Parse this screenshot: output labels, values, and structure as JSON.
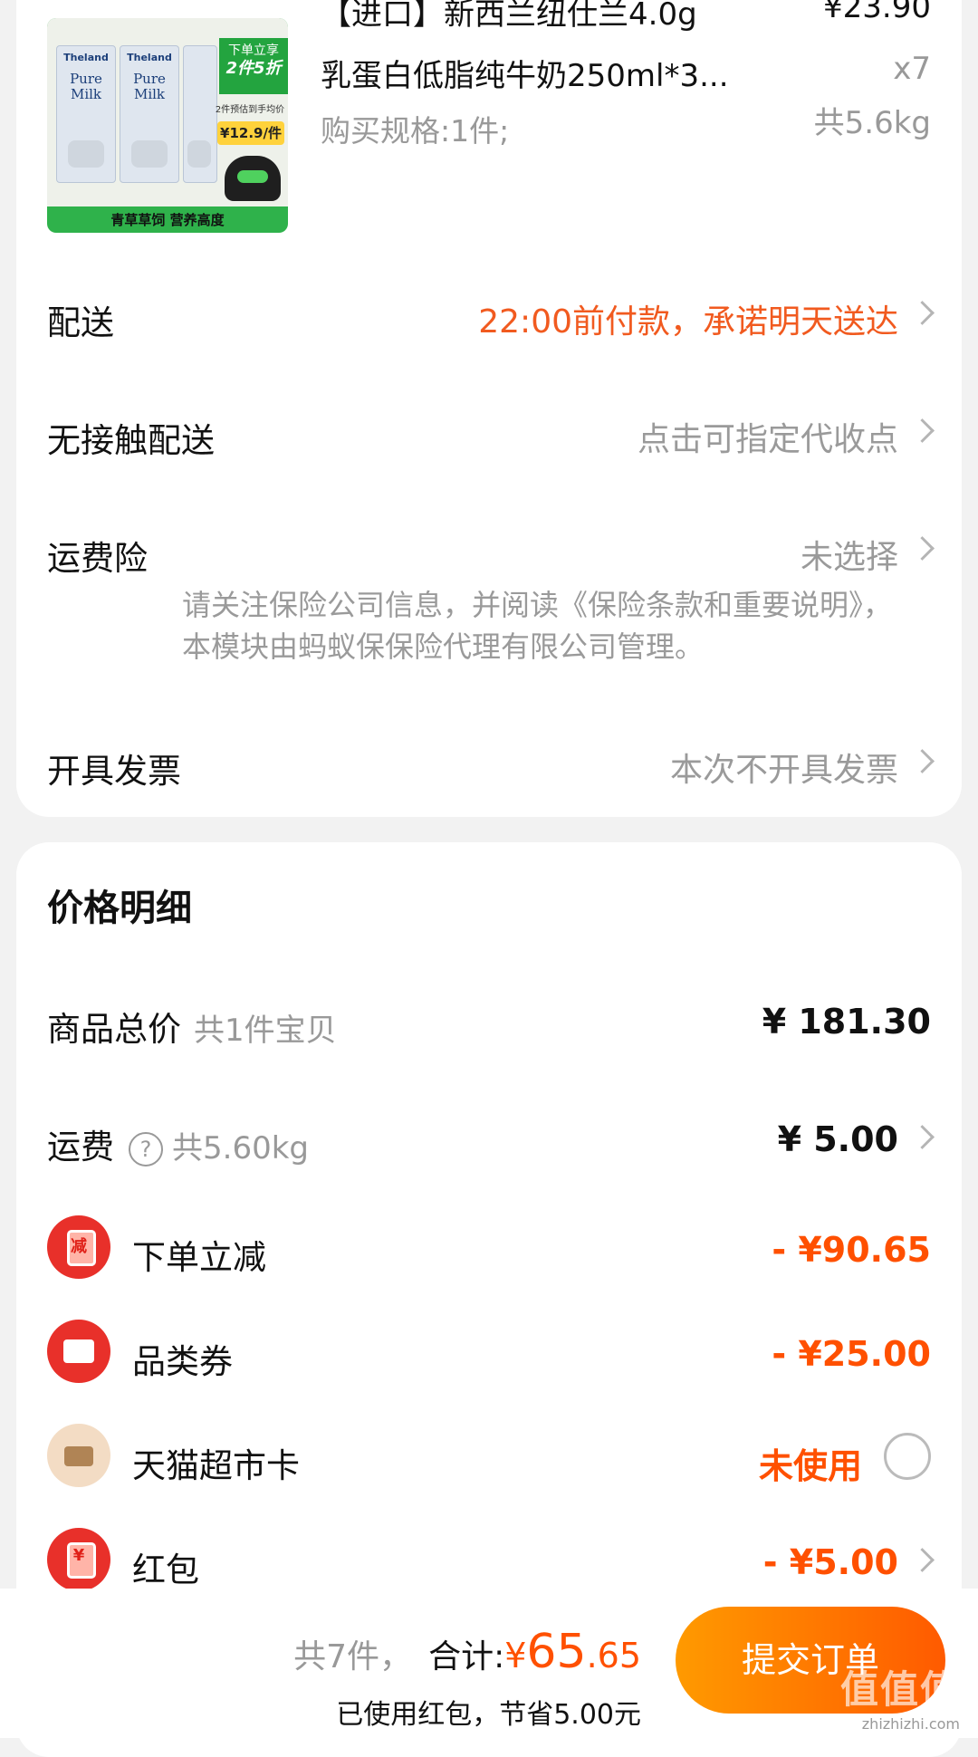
{
  "product": {
    "title_line1": "【进口】新西兰纽仕兰4.0g",
    "title_line2": "乳蛋白低脂纯牛奶250ml*3...",
    "spec": "购买规格:1件;",
    "price": "¥23.90",
    "quantity": "x7",
    "weight": "共5.6kg",
    "image": {
      "brand": "Theland",
      "pure_milk": "Pure Milk",
      "promo_line1": "下单立享",
      "promo_line2": "2件5折",
      "promo_sub": "2件预估到手均价",
      "promo_price": "¥12.9/件",
      "slogan": "青草草饲 营养高度"
    }
  },
  "rows": {
    "delivery": {
      "label": "配送",
      "value": "22:00前付款，承诺明天送达"
    },
    "contactless": {
      "label": "无接触配送",
      "value": "点击可指定代收点"
    },
    "insurance": {
      "label": "运费险",
      "value": "未选择",
      "note": "请关注保险公司信息，并阅读《保险条款和重要说明》，本模块由蚂蚁保保险代理有限公司管理。"
    },
    "invoice": {
      "label": "开具发票",
      "value": "本次不开具发票"
    }
  },
  "price_detail": {
    "title": "价格明细",
    "goods_total": {
      "label": "商品总价",
      "sub": "共1件宝贝",
      "amount": "¥ 181.30"
    },
    "shipping": {
      "label": "运费",
      "sub": "共5.60kg",
      "amount": "¥ 5.00",
      "help": "?"
    },
    "instant_discount": {
      "label": "下单立减",
      "amount": "- ¥90.65",
      "icon_glyph": "减"
    },
    "category_coupon": {
      "label": "品类券",
      "amount": "- ¥25.00"
    },
    "tmall_card": {
      "label": "天猫超市卡",
      "status": "未使用"
    },
    "red_packet": {
      "label": "红包",
      "amount": "- ¥5.00",
      "icon_glyph": "¥"
    }
  },
  "bottom": {
    "count": "共7件，",
    "total_label": "合计:",
    "currency": "¥",
    "total_int": "65",
    "total_dec": ".65",
    "saved": "已使用红包，节省5.00元",
    "submit": "提交订单",
    "watermark": "值值值",
    "watermark_site": "zhizhizhi.com"
  },
  "colors": {
    "accent": "#ff5000",
    "delivery_text": "#f15a1f"
  }
}
